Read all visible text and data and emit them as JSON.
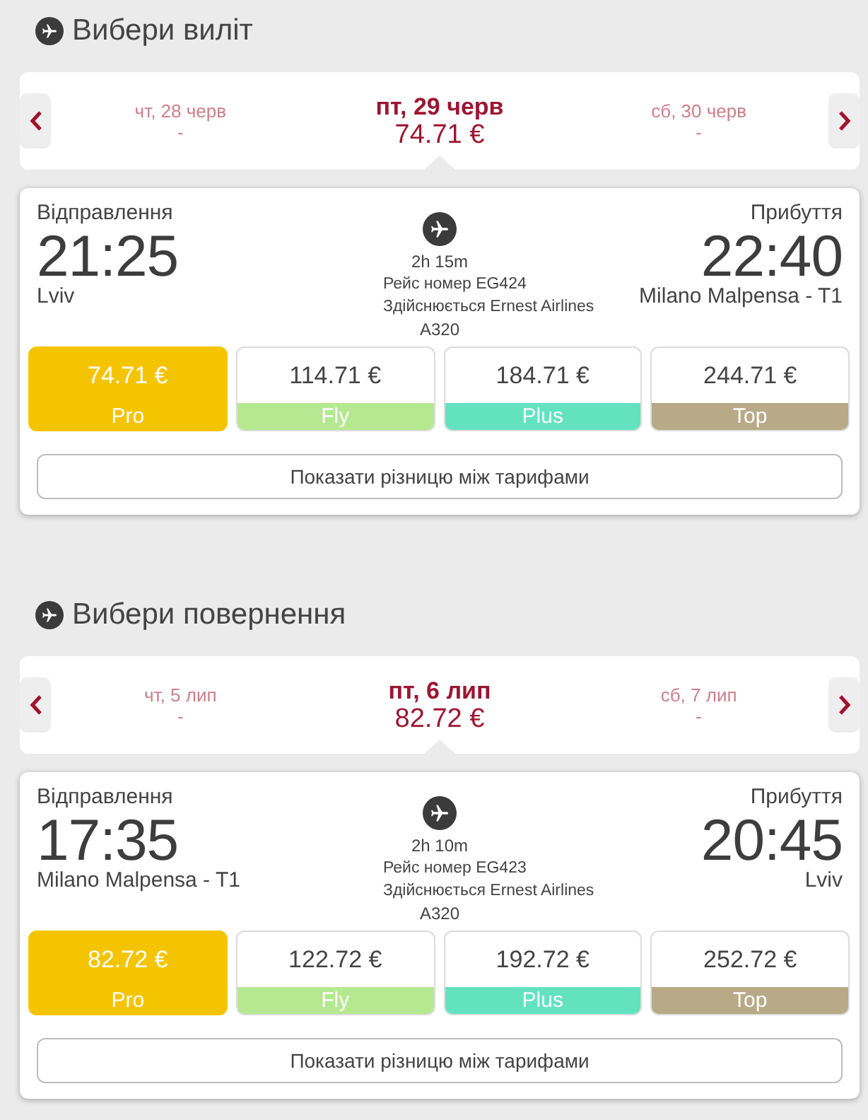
{
  "sections": [
    {
      "title": "Вибери виліт",
      "dates": [
        {
          "label": "чт, 28 черв",
          "price": "-",
          "selected": false
        },
        {
          "label": "пт, 29 черв",
          "price": "74.71 €",
          "selected": true
        },
        {
          "label": "сб, 30 черв",
          "price": "-",
          "selected": false
        }
      ],
      "flight": {
        "departure_label": "Відправлення",
        "departure_time": "21:25",
        "departure_place": "Lviv",
        "duration": "2h 15m",
        "flight_number": "Рейс номер EG424",
        "operator": "Здійснюється Ernest Airlines",
        "aircraft": "A320",
        "arrival_label": "Прибуття",
        "arrival_time": "22:40",
        "arrival_place": "Milano Malpensa - T1"
      },
      "fares": [
        {
          "price": "74.71 €",
          "name": "Pro",
          "color": "#f5c400",
          "selected": true
        },
        {
          "price": "114.71 €",
          "name": "Fly",
          "color": "#b5e890",
          "selected": false
        },
        {
          "price": "184.71 €",
          "name": "Plus",
          "color": "#63e2c0",
          "selected": false
        },
        {
          "price": "244.71 €",
          "name": "Top",
          "color": "#b8aa86",
          "selected": false
        }
      ],
      "compare_button": "Показати різницю між тарифами"
    },
    {
      "title": "Вибери повернення",
      "dates": [
        {
          "label": "чт, 5 лип",
          "price": "-",
          "selected": false
        },
        {
          "label": "пт, 6 лип",
          "price": "82.72 €",
          "selected": true
        },
        {
          "label": "сб, 7 лип",
          "price": "-",
          "selected": false
        }
      ],
      "flight": {
        "departure_label": "Відправлення",
        "departure_time": "17:35",
        "departure_place": "Milano Malpensa - T1",
        "duration": "2h 10m",
        "flight_number": "Рейс номер EG423",
        "operator": "Здійснюється Ernest Airlines",
        "aircraft": "A320",
        "arrival_label": "Прибуття",
        "arrival_time": "20:45",
        "arrival_place": "Lviv"
      },
      "fares": [
        {
          "price": "82.72 €",
          "name": "Pro",
          "color": "#f5c400",
          "selected": true
        },
        {
          "price": "122.72 €",
          "name": "Fly",
          "color": "#b5e890",
          "selected": false
        },
        {
          "price": "192.72 €",
          "name": "Plus",
          "color": "#63e2c0",
          "selected": false
        },
        {
          "price": "252.72 €",
          "name": "Top",
          "color": "#b8aa86",
          "selected": false
        }
      ],
      "compare_button": "Показати різницю між тарифами"
    }
  ]
}
